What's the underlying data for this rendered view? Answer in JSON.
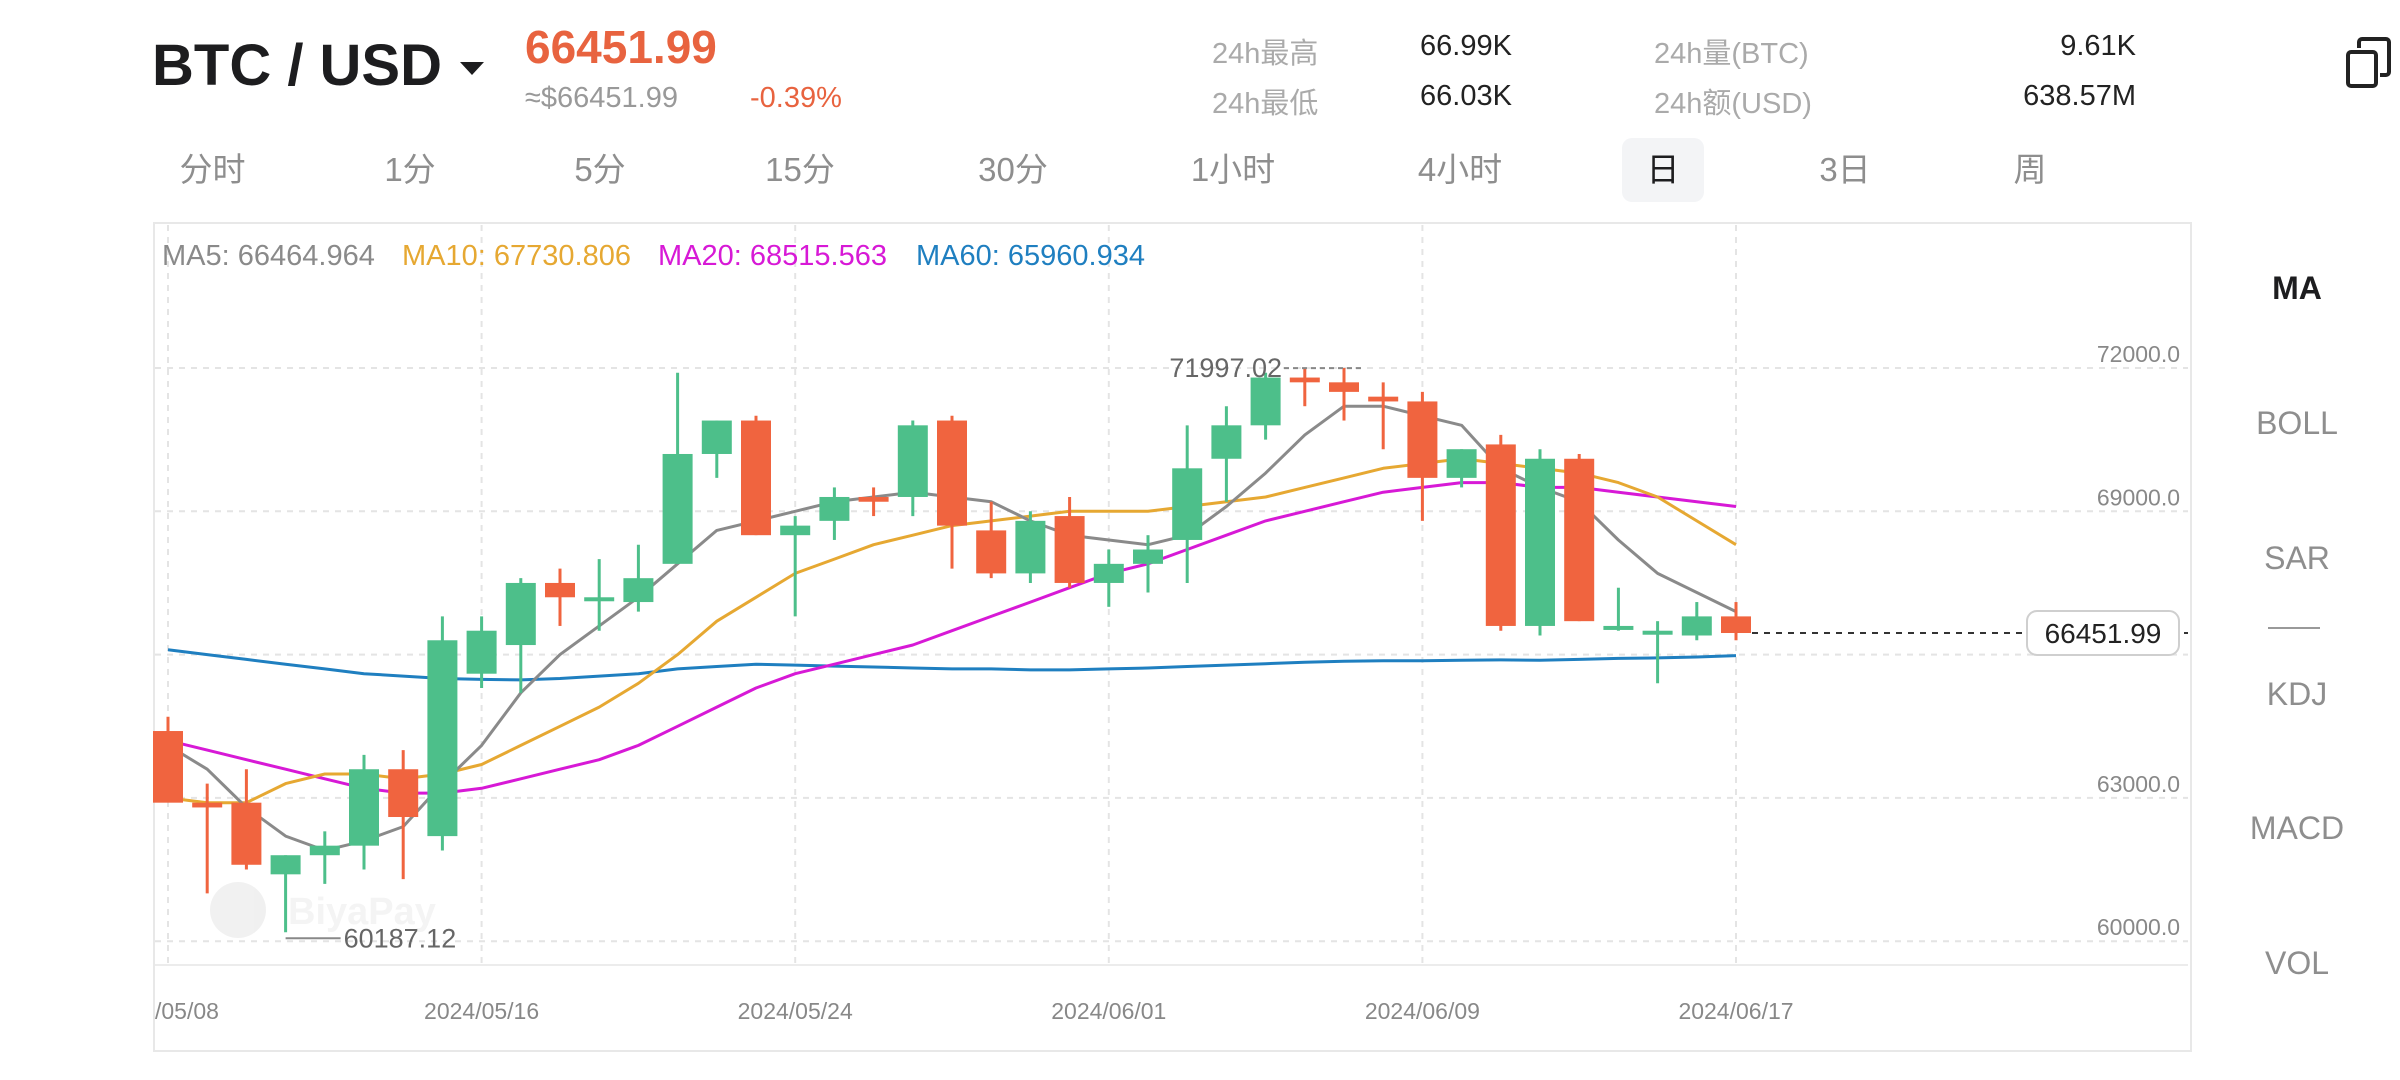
{
  "header": {
    "pair": "BTC / USD",
    "last_price": "66451.99",
    "approx_price": "≈$66451.99",
    "change_pct": "-0.39%",
    "stats": [
      {
        "label": "24h最高",
        "value": "66.99K"
      },
      {
        "label": "24h最低",
        "value": "66.03K"
      },
      {
        "label": "24h量(BTC)",
        "value": "9.61K"
      },
      {
        "label": "24h额(USD)",
        "value": "638.57M"
      }
    ]
  },
  "tabs": [
    "分时",
    "1分",
    "5分",
    "15分",
    "30分",
    "1小时",
    "4小时",
    "日",
    "3日",
    "周"
  ],
  "active_tab": "日",
  "indicators": {
    "items": [
      "MA",
      "BOLL",
      "SAR",
      "KDJ",
      "MACD",
      "VOL"
    ],
    "active": "MA"
  },
  "legend": {
    "ma5": "MA5: 66464.964",
    "ma10": "MA10: 67730.806",
    "ma20": "MA20: 68515.563",
    "ma60": "MA60: 65960.934"
  },
  "colors": {
    "up": "#4dbf8a",
    "down": "#f0643f",
    "ma5": "#8a8a8a",
    "ma10": "#e6a832",
    "ma20": "#d719d6",
    "ma60": "#1f7fc0",
    "accent_price": "#e8633f"
  },
  "icons": {
    "copy": "copy-icon",
    "dropdown": "chevron-down-icon"
  },
  "chart_data": {
    "type": "candlestick",
    "interval": "daily",
    "ylim": [
      58800,
      73200
    ],
    "yticks": [
      "72000.0",
      "69000.0",
      "66000.0",
      "63000.0",
      "60000.0"
    ],
    "ytick_values": [
      72000,
      69000,
      66000,
      63000,
      60000
    ],
    "xtick_labels": [
      "/05/08",
      "2024/05/16",
      "2024/05/24",
      "2024/06/01",
      "2024/06/09",
      "2024/06/17"
    ],
    "xtick_index": [
      0,
      8,
      16,
      24,
      32,
      40
    ],
    "current_price_label": "66451.99",
    "current_price": 66451.99,
    "max_label": "71997.02",
    "max_value": 71997.02,
    "max_index": 30,
    "min_label": "60187.12",
    "min_value": 60187.12,
    "min_index": 3,
    "watermark": "BiyaPay",
    "candles": [
      {
        "d": "05/08",
        "o": 64400,
        "h": 64700,
        "l": 63100,
        "c": 62900
      },
      {
        "d": "05/09",
        "o": 62900,
        "h": 63300,
        "l": 61000,
        "c": 62800
      },
      {
        "d": "05/10",
        "o": 62900,
        "h": 63600,
        "l": 61500,
        "c": 61600
      },
      {
        "d": "05/11",
        "o": 61400,
        "h": 61800,
        "l": 60187,
        "c": 61800
      },
      {
        "d": "05/12",
        "o": 61800,
        "h": 62300,
        "l": 61200,
        "c": 62000
      },
      {
        "d": "05/13",
        "o": 62000,
        "h": 63900,
        "l": 61500,
        "c": 63600
      },
      {
        "d": "05/14",
        "o": 63600,
        "h": 64000,
        "l": 61300,
        "c": 62600
      },
      {
        "d": "05/15",
        "o": 62200,
        "h": 66800,
        "l": 61900,
        "c": 66300
      },
      {
        "d": "05/16",
        "o": 65600,
        "h": 66800,
        "l": 65300,
        "c": 66500
      },
      {
        "d": "05/17",
        "o": 66200,
        "h": 67600,
        "l": 65200,
        "c": 67500
      },
      {
        "d": "05/18",
        "o": 67500,
        "h": 67800,
        "l": 66600,
        "c": 67200
      },
      {
        "d": "05/19",
        "o": 67200,
        "h": 68000,
        "l": 66500,
        "c": 67200
      },
      {
        "d": "05/20",
        "o": 67100,
        "h": 68300,
        "l": 66900,
        "c": 67600
      },
      {
        "d": "05/21",
        "o": 67900,
        "h": 71900,
        "l": 67900,
        "c": 70200
      },
      {
        "d": "05/22",
        "o": 70200,
        "h": 70900,
        "l": 69700,
        "c": 70900
      },
      {
        "d": "05/23",
        "o": 70900,
        "h": 71000,
        "l": 68500,
        "c": 68500
      },
      {
        "d": "05/24",
        "o": 68500,
        "h": 68900,
        "l": 66800,
        "c": 68700
      },
      {
        "d": "05/25",
        "o": 68800,
        "h": 69500,
        "l": 68400,
        "c": 69300
      },
      {
        "d": "05/26",
        "o": 69300,
        "h": 69500,
        "l": 68900,
        "c": 69200
      },
      {
        "d": "05/27",
        "o": 69300,
        "h": 70900,
        "l": 68900,
        "c": 70800
      },
      {
        "d": "05/28",
        "o": 70900,
        "h": 71000,
        "l": 67800,
        "c": 68700
      },
      {
        "d": "05/29",
        "o": 68600,
        "h": 69200,
        "l": 67600,
        "c": 67700
      },
      {
        "d": "05/30",
        "o": 67700,
        "h": 69000,
        "l": 67500,
        "c": 68800
      },
      {
        "d": "05/31",
        "o": 68900,
        "h": 69300,
        "l": 67400,
        "c": 67500
      },
      {
        "d": "06/01",
        "o": 67500,
        "h": 68200,
        "l": 67000,
        "c": 67900
      },
      {
        "d": "06/02",
        "o": 67900,
        "h": 68500,
        "l": 67300,
        "c": 68200
      },
      {
        "d": "06/03",
        "o": 68400,
        "h": 70800,
        "l": 67500,
        "c": 69900
      },
      {
        "d": "06/04",
        "o": 70100,
        "h": 71200,
        "l": 69200,
        "c": 70800
      },
      {
        "d": "06/05",
        "o": 70800,
        "h": 71900,
        "l": 70500,
        "c": 71800
      },
      {
        "d": "06/06",
        "o": 71800,
        "h": 71997,
        "l": 71200,
        "c": 71700
      },
      {
        "d": "06/07",
        "o": 71700,
        "h": 72000,
        "l": 70900,
        "c": 71500
      },
      {
        "d": "06/08",
        "o": 71400,
        "h": 71700,
        "l": 70300,
        "c": 71300
      },
      {
        "d": "06/09",
        "o": 71300,
        "h": 71500,
        "l": 68800,
        "c": 69700
      },
      {
        "d": "06/10",
        "o": 69700,
        "h": 70300,
        "l": 69500,
        "c": 70300
      },
      {
        "d": "06/11",
        "o": 70400,
        "h": 70600,
        "l": 66500,
        "c": 66600
      },
      {
        "d": "06/12",
        "o": 66600,
        "h": 70300,
        "l": 66400,
        "c": 70100
      },
      {
        "d": "06/13",
        "o": 70100,
        "h": 70200,
        "l": 66700,
        "c": 66700
      },
      {
        "d": "06/14",
        "o": 66600,
        "h": 67400,
        "l": 66500,
        "c": 66600
      },
      {
        "d": "06/15",
        "o": 66500,
        "h": 66700,
        "l": 65400,
        "c": 66500
      },
      {
        "d": "06/16",
        "o": 66400,
        "h": 67100,
        "l": 66300,
        "c": 66800
      },
      {
        "d": "06/17",
        "o": 66800,
        "h": 67100,
        "l": 66300,
        "c": 66452
      }
    ],
    "ma5": [
      64100,
      63600,
      62800,
      62200,
      61900,
      62100,
      62400,
      63300,
      64100,
      65200,
      66000,
      66600,
      67200,
      67900,
      68600,
      68800,
      69000,
      69200,
      69300,
      69400,
      69300,
      69200,
      68800,
      68500,
      68400,
      68300,
      68500,
      69100,
      69800,
      70600,
      71200,
      71200,
      71000,
      70800,
      69900,
      69500,
      69200,
      68400,
      67700,
      67300,
      66900
    ],
    "ma10": [
      63000,
      62900,
      62900,
      63300,
      63500,
      63500,
      63400,
      63500,
      63700,
      64100,
      64500,
      64900,
      65400,
      66000,
      66700,
      67200,
      67700,
      68000,
      68300,
      68500,
      68700,
      68800,
      68900,
      69000,
      69000,
      69000,
      69100,
      69200,
      69300,
      69500,
      69700,
      69900,
      70000,
      70100,
      70000,
      69900,
      69800,
      69600,
      69300,
      68800,
      68300
    ],
    "ma20": [
      64200,
      64000,
      63800,
      63600,
      63400,
      63200,
      63100,
      63100,
      63200,
      63400,
      63600,
      63800,
      64100,
      64500,
      64900,
      65300,
      65600,
      65800,
      66000,
      66200,
      66500,
      66800,
      67100,
      67400,
      67700,
      67900,
      68200,
      68500,
      68800,
      69000,
      69200,
      69400,
      69500,
      69600,
      69600,
      69500,
      69500,
      69400,
      69300,
      69200,
      69100
    ],
    "ma60": [
      66100,
      66000,
      65900,
      65800,
      65700,
      65600,
      65550,
      65500,
      65480,
      65470,
      65500,
      65550,
      65600,
      65700,
      65750,
      65800,
      65780,
      65760,
      65740,
      65720,
      65700,
      65700,
      65680,
      65680,
      65700,
      65720,
      65750,
      65780,
      65810,
      65840,
      65860,
      65870,
      65870,
      65880,
      65890,
      65880,
      65900,
      65920,
      65930,
      65950,
      65980
    ]
  }
}
